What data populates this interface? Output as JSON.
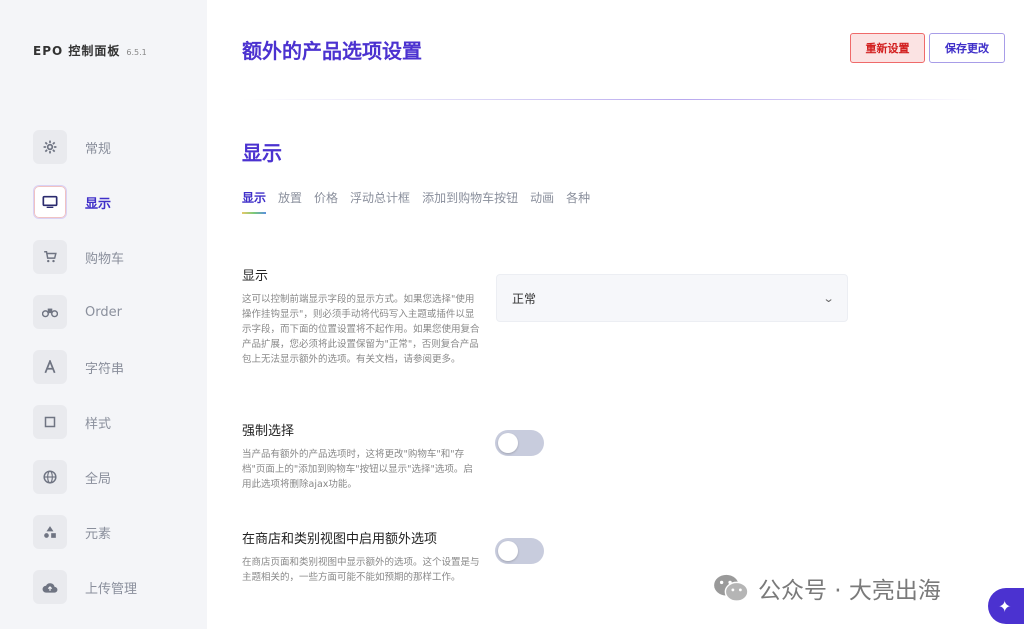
{
  "sidebar": {
    "brand": "EPO 控制面板",
    "version": "6.5.1",
    "items": [
      {
        "label": "常规",
        "icon": "gear-icon"
      },
      {
        "label": "显示",
        "icon": "monitor-icon",
        "active": true
      },
      {
        "label": "购物车",
        "icon": "cart-icon"
      },
      {
        "label": "Order",
        "icon": "order-icon"
      },
      {
        "label": "字符串",
        "icon": "font-icon"
      },
      {
        "label": "样式",
        "icon": "square-icon"
      },
      {
        "label": "全局",
        "icon": "globe-icon"
      },
      {
        "label": "元素",
        "icon": "shapes-icon"
      },
      {
        "label": "上传管理",
        "icon": "cloud-upload-icon"
      }
    ]
  },
  "header": {
    "title": "额外的产品选项设置",
    "reset_label": "重新设置",
    "save_label": "保存更改"
  },
  "section": {
    "title": "显示",
    "tabs": [
      "显示",
      "放置",
      "价格",
      "浮动总计框",
      "添加到购物车按钮",
      "动画",
      "各种"
    ]
  },
  "settings": {
    "display": {
      "title": "显示",
      "desc": "这可以控制前端显示字段的显示方式。如果您选择\"使用操作挂钩显示\"，则必须手动将代码写入主题或插件以显示字段，而下面的位置设置将不起作用。如果您使用复合产品扩展，您必须将此设置保留为\"正常\"，否则复合产品包上无法显示额外的选项。有关文档，请参阅更多。",
      "value": "正常"
    },
    "force_select": {
      "title": "强制选择",
      "desc": "当产品有额外的产品选项时，这将更改\"购物车\"和\"存档\"页面上的\"添加到购物车\"按钮以显示\"选择\"选项。启用此选项将删除ajax功能。",
      "enabled": false
    },
    "shop_view": {
      "title": "在商店和类别视图中启用额外选项",
      "desc": "在商店页面和类别视图中显示额外的选项。这个设置是与主题相关的，一些方面可能不能如预期的那样工作。",
      "enabled": false
    }
  },
  "watermark": {
    "text": "公众号 · 大亮出海"
  },
  "colors": {
    "accent": "#4b32d0",
    "danger": "#d21f1f",
    "sidebar_bg": "#f4f5f8"
  }
}
